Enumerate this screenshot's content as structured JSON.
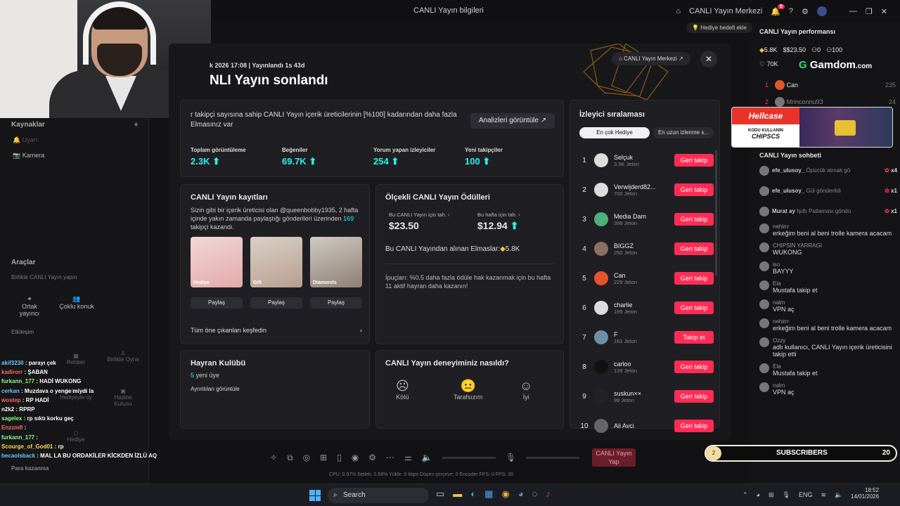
{
  "titlebar": {
    "title": "CANLI Yayın bilgileri",
    "center_btn": "CANLI Yayın Merkezi",
    "notif_count": "5"
  },
  "left": {
    "sources_title": "Kaynaklar",
    "source1": "Uyarı",
    "source2": "Kamera",
    "tools_title": "Araçlar",
    "tools_sub": "Birlikte CANLI Yayın yapın",
    "tool1": "Ortak yayıncı",
    "tool2": "Çoklu konuk",
    "interact_title": "Etkileşim",
    "i1": "Rehber",
    "i2": "Birlikte Oyna",
    "i3": "Anket ve Hediyeyle oy",
    "i4": "Hazine Kutusu",
    "i5": "Hediye",
    "earn": "Para kazanma"
  },
  "overlay_chat": [
    {
      "name": "akif3230",
      "msg": ": parayı çek",
      "color": "#6ac8ff"
    },
    {
      "name": "kadirorr",
      "msg": ": ŞABAN",
      "color": "#ff6a6a"
    },
    {
      "name": "furkann_177",
      "msg": ": HADİ WUKONG",
      "color": "#8aff8a"
    },
    {
      "name": "cerkan",
      "msg": ": Muzdava o yenge miydi la",
      "color": "#6ac8ff"
    },
    {
      "name": "wostep",
      "msg": ": RP HADİ",
      "color": "#ff6a6a"
    },
    {
      "name": "n2k2",
      "msg": ": RPRP",
      "color": "#ffffff"
    },
    {
      "name": "sagelex",
      "msg": ": rp sıktı korku geç",
      "color": "#8aff8a"
    },
    {
      "name": "Enzzmfl",
      "msg": ":",
      "color": "#ff6a6a"
    },
    {
      "name": "furkann_177",
      "msg": ":",
      "color": "#8aff8a"
    },
    {
      "name": "Scourge_of_God01",
      "msg": ": rp",
      "color": "#ffdd55"
    },
    {
      "name": "becaolsback",
      "msg": ": MAL LA BU ORDAKİLER KİCKDEN İZLÜ AQ",
      "color": "#6ac8ff"
    }
  ],
  "main": {
    "date": "k 2026 17:08 | Yayınlandı 1s 43d",
    "title": "NLI Yayın sonlandı",
    "center_link": "CANLI Yayın Merkezi",
    "summary_text": "r takipçi sayısına sahip CANLI Yayın içerik üreticilerinin [%100] kadarından daha fazla Elmasınız var",
    "analytics_btn": "Analizleri görüntüle",
    "stats": [
      {
        "label": "Toplam görüntüleme",
        "value": "2.3K"
      },
      {
        "label": "Beğeniler",
        "value": "69.7K"
      },
      {
        "label": "Yorum yapan izleyiciler",
        "value": "254"
      },
      {
        "label": "Yeni takipçiler",
        "value": "100"
      }
    ],
    "records": {
      "title": "CANLI Yayın kayıtları",
      "desc_a": "Sizin gibi bir içerik üreticisi olan @queenbobby1935, 2 hafta içinde yakın zamanda paylaştığı gönderileri üzerinden ",
      "desc_num": "169",
      "desc_b": " takipçi kazandı.",
      "thumbs": [
        {
          "cap": "Hediye",
          "share": "Paylaş"
        },
        {
          "cap": "Gift",
          "share": "Paylaş"
        },
        {
          "cap": "Diamonds",
          "share": "Paylaş"
        }
      ],
      "explore": "Tüm öne çıkanları keşfedin"
    },
    "rewards": {
      "title": "Ölçekli CANLI Yayın Ödülleri",
      "live_label": "Bu CANLI Yayın için tah.",
      "live_value": "$23.50",
      "week_label": "Bu hafta için tah.",
      "week_value": "$12.94",
      "diamonds": "Bu CANLI Yayından alınan Elmaslar:",
      "diamonds_val": "5.8K",
      "tip": "İpuçları: %0.5 daha fazla ödüle hak kazanmak için bu hafta 11 aktif hayran daha kazanın!"
    },
    "fanclub": {
      "title": "Hayran Kulübü",
      "new_num": "5",
      "new_label": " yeni üye",
      "details": "Ayrıntıları görüntüle"
    },
    "feedback": {
      "title": "CANLI Yayın deneyiminiz nasıldı?",
      "opt1": "Kötü",
      "opt2": "Tarafsızım",
      "opt3": "İyi"
    },
    "ranking": {
      "title": "İzleyici sıralaması",
      "tab1": "En çok Hediye",
      "tab2": "En uzun izlenme s...",
      "viewers": [
        {
          "rank": "1",
          "name": "Selçuk",
          "jeton": "3.5K Jeton",
          "btn": "Geri takip",
          "color": "#dcdcdc"
        },
        {
          "rank": "2",
          "name": "Verwijderd82...",
          "jeton": "700 Jeton",
          "btn": "Geri takip",
          "color": "#dcdcdc"
        },
        {
          "rank": "3",
          "name": "Media Dam",
          "jeton": "398 Jeton",
          "btn": "Geri takip",
          "color": "#4caf7d"
        },
        {
          "rank": "4",
          "name": "BIGGZ",
          "jeton": "250 Jeton",
          "btn": "Geri takip",
          "color": "#8a7060"
        },
        {
          "rank": "5",
          "name": "Can",
          "jeton": "229 Jeton",
          "btn": "Geri takip",
          "color": "#e5532d"
        },
        {
          "rank": "6",
          "name": "charlie",
          "jeton": "199 Jeton",
          "btn": "Geri takip",
          "color": "#dcdcdc"
        },
        {
          "rank": "7",
          "name": "F",
          "jeton": "161 Jeton",
          "btn": "Takip et",
          "color": "#6f8fa8"
        },
        {
          "rank": "8",
          "name": "carloo",
          "jeton": "139 Jeton",
          "btn": "Geri takip",
          "color": "#111111"
        },
        {
          "rank": "9",
          "name": "suskun××",
          "jeton": "99 Jeton",
          "btn": "Geri takip",
          "color": "#222222"
        },
        {
          "rank": "10",
          "name": "Ali Avci",
          "jeton": "",
          "btn": "Geri takip",
          "color": "#666666"
        }
      ]
    }
  },
  "right": {
    "goal": "Hediye hedefi ekle",
    "perf_title": "CANLI Yayın performansı",
    "perf1": "5.8K",
    "perf2": "$23.50",
    "perf3": "0",
    "perf4": "100",
    "perf5": "70K",
    "gamdom": "Gamdom",
    "gamdom_tld": ".com",
    "top1_name": "Can",
    "top1_val": "235",
    "top2_name": "Mrinconnu93",
    "top2_val": "24",
    "hellcase": "Hellcase",
    "hc_line1": "KODU KULLANIN",
    "hc_line2": "CHIPSCS",
    "chat_title": "CANLI Yayın sohbeti",
    "gifts": [
      {
        "name": "efe_ulusoy_",
        "msg": "Öpücük atmak gö",
        "count": "x4"
      },
      {
        "name": "efe_ulusoy_",
        "msg": "Gül gönderildi",
        "count": "x1"
      },
      {
        "name": "Murat ay",
        "msg": "Işıltı Patlaması göndo",
        "count": "x1"
      }
    ],
    "chat": [
      {
        "name": "nehirrr",
        "msg": "erkeğim beni al beni trolle kamera acacam"
      },
      {
        "name": "CHIPSIN YARRAGI",
        "msg": "WUKONG"
      },
      {
        "name": "iso",
        "msg": "BAYYY"
      },
      {
        "name": "Ela",
        "msg": "Mustafa takip et"
      },
      {
        "name": "nalm",
        "msg": "VPN aç"
      },
      {
        "name": "nehirrr",
        "msg": "erkeğim beni al beni trolle kamera acacam"
      },
      {
        "name": "Ozzy",
        "msg": "adlı kullanıcı, CANLI Yayın içerik üreticisini takip etti"
      },
      {
        "name": "Ela",
        "msg": "Mustafa takip et"
      },
      {
        "name": "nalm",
        "msg": "VPN aç"
      }
    ],
    "subs_label": "SUBSCRIBERS",
    "subs_count": "20",
    "subs_num": "2"
  },
  "bottom": {
    "go_live": "CANLI Yayın Yap",
    "status": "CPU: 0.97%     Bellek: 0.58%     Yükle: 0 kbps     Düşen çerçeve: 0     Encoder FPS: 0     FPS: 30"
  },
  "taskbar": {
    "search": "Search",
    "lang": "ENG",
    "time": "18:52",
    "date": "14/01/2026"
  }
}
